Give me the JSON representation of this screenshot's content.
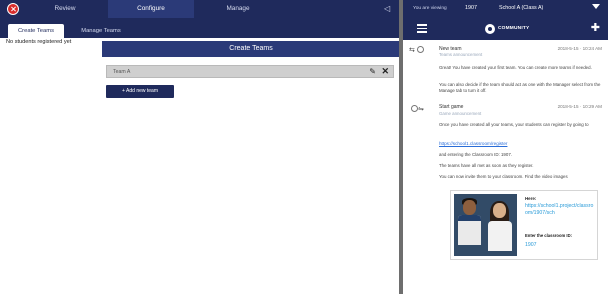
{
  "nav": {
    "tabs": [
      {
        "label": "Review"
      },
      {
        "label": "Configure"
      },
      {
        "label": "Manage"
      }
    ],
    "collapse_glyph": "◁"
  },
  "subtabs": [
    {
      "label": "Create Teams"
    },
    {
      "label": "Manage Teams"
    }
  ],
  "left": {
    "no_students": "No students registered yet",
    "panel_title": "Create Teams",
    "team": {
      "name": "Team A"
    },
    "add_team_label": "+ Add new team"
  },
  "right": {
    "top": {
      "label": "You are viewing",
      "code": "1907",
      "school": "School A (Class A)"
    },
    "brand": "COMMUNITY",
    "posts": [
      {
        "author": "New team",
        "sub": "Teams announcement",
        "date": "2018-5-15 · 10:24 AM",
        "text": [
          "Great! You have created your first team. You can create more teams if needed.",
          "You can also decide if the team should act as one with the Manager select from the Manage tab to turn it off."
        ]
      },
      {
        "author": "Start game",
        "sub": "Game announcement",
        "date": "2018-5-15 · 10:29 AM",
        "text": [
          "Once you have created all your teams, your students can register by going to",
          "and entering the Classroom ID: 1907.",
          "The teams have all met as soon as they register.",
          "You can now invite them to your classroom. Find the video images"
        ],
        "link": "https://school1.classroom/register"
      }
    ],
    "card": {
      "label1": "Here:",
      "link": "https://school1.project/classroom/1907/sch",
      "label2": "Enter the classroom ID:",
      "code": "1907"
    }
  }
}
